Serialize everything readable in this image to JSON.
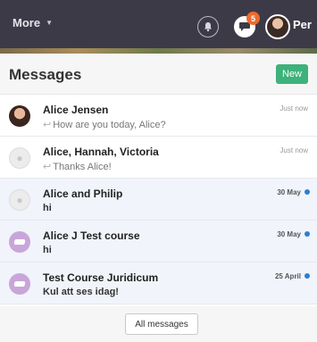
{
  "topbar": {
    "more_label": "More",
    "notification_count": "5",
    "user_name": "Per"
  },
  "panel": {
    "title": "Messages",
    "new_label": "New",
    "all_messages_label": "All messages"
  },
  "messages": [
    {
      "name": "Alice Jensen",
      "preview": "How are you today, Alice?",
      "time": "Just now",
      "unread": false,
      "avatar": "photo",
      "reply": true
    },
    {
      "name": "Alice, Hannah, Victoria",
      "preview": "Thanks Alice!",
      "time": "Just now",
      "unread": false,
      "avatar": "group",
      "reply": true
    },
    {
      "name": "Alice and Philip",
      "preview": "hi",
      "time": "30 May",
      "unread": true,
      "avatar": "group",
      "reply": false
    },
    {
      "name": "Alice J Test course",
      "preview": "hi",
      "time": "30 May",
      "unread": true,
      "avatar": "course",
      "reply": false
    },
    {
      "name": "Test Course Juridicum",
      "preview": "Kul att ses idag!",
      "time": "25 April",
      "unread": true,
      "avatar": "course",
      "reply": false
    }
  ],
  "colors": {
    "topbar": "#3d3a47",
    "accent_green": "#3db27a",
    "badge_orange": "#f06a2a",
    "unread_dot": "#2a7fd4"
  }
}
